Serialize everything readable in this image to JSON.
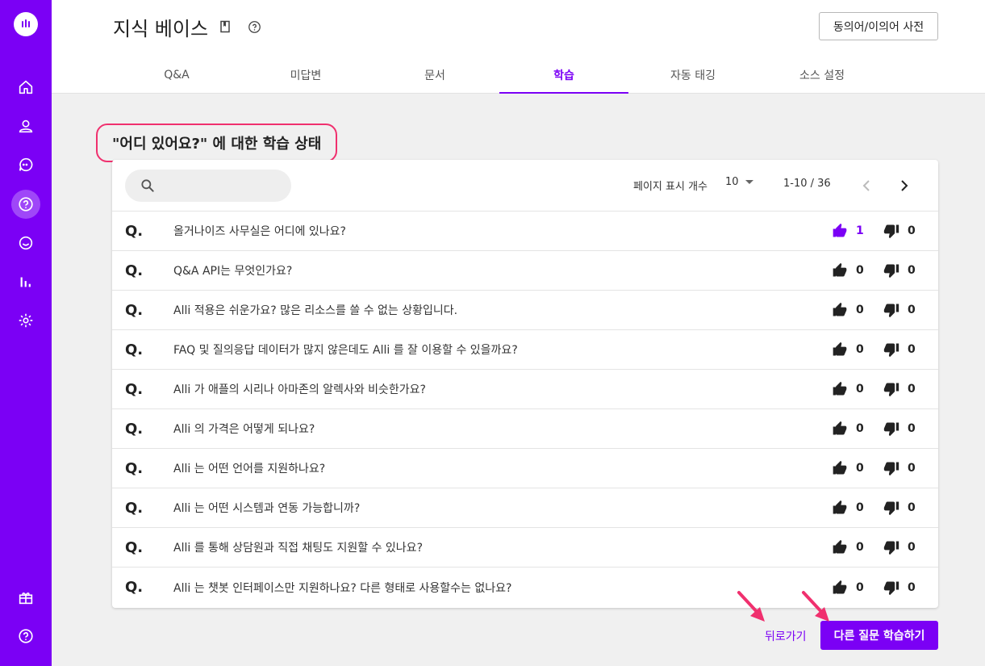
{
  "header": {
    "title": "지식 베이스",
    "dictionary_button": "동의어/이의어 사전"
  },
  "tabs": [
    {
      "label": "Q&A"
    },
    {
      "label": "미답변"
    },
    {
      "label": "문서"
    },
    {
      "label": "학습",
      "active": true
    },
    {
      "label": "자동 태깅"
    },
    {
      "label": "소스 설정"
    }
  ],
  "section": {
    "title": "\"어디 있어요?\" 에 대한 학습 상태"
  },
  "search": {
    "value": ""
  },
  "pagination": {
    "per_page_label": "페이지 표시 개수",
    "per_page_value": "10",
    "range": "1-10 / 36"
  },
  "rows": [
    {
      "q": "Q.",
      "text": "올거나이즈 사무실은 어디에 있나요?",
      "likes": "1",
      "dislikes": "0",
      "liked": true
    },
    {
      "q": "Q.",
      "text": "Q&A API는 무엇인가요?",
      "likes": "0",
      "dislikes": "0",
      "liked": false
    },
    {
      "q": "Q.",
      "text": "Alli 적용은 쉬운가요? 많은 리소스를 쓸 수 없는 상황입니다.",
      "likes": "0",
      "dislikes": "0",
      "liked": false
    },
    {
      "q": "Q.",
      "text": "FAQ 및 질의응답 데이터가 많지 않은데도 Alli 를 잘 이용할 수 있을까요?",
      "likes": "0",
      "dislikes": "0",
      "liked": false
    },
    {
      "q": "Q.",
      "text": "Alli 가 애플의 시리나 아마존의 알렉사와 비슷한가요?",
      "likes": "0",
      "dislikes": "0",
      "liked": false
    },
    {
      "q": "Q.",
      "text": "Alli 의 가격은 어떻게 되나요?",
      "likes": "0",
      "dislikes": "0",
      "liked": false
    },
    {
      "q": "Q.",
      "text": "Alli 는 어떤 언어를 지원하나요?",
      "likes": "0",
      "dislikes": "0",
      "liked": false
    },
    {
      "q": "Q.",
      "text": "Alli 는 어떤 시스템과 연동 가능합니까?",
      "likes": "0",
      "dislikes": "0",
      "liked": false
    },
    {
      "q": "Q.",
      "text": "Alli 를 통해 상담원과 직접 채팅도 지원할 수 있나요?",
      "likes": "0",
      "dislikes": "0",
      "liked": false
    },
    {
      "q": "Q.",
      "text": "Alli 는 챗봇 인터페이스만 지원하나요? 다른 형태로 사용할수는 없나요?",
      "likes": "0",
      "dislikes": "0",
      "liked": false
    }
  ],
  "footer": {
    "back_label": "뒤로가기",
    "primary_label": "다른 질문 학습하기"
  },
  "sidebar": {
    "items": [
      {
        "icon": "home-icon"
      },
      {
        "icon": "user-icon"
      },
      {
        "icon": "chat-icon"
      },
      {
        "icon": "knowledge-base-icon",
        "active": true
      },
      {
        "icon": "conversation-icon"
      },
      {
        "icon": "analytics-icon"
      },
      {
        "icon": "settings-icon"
      },
      {
        "icon": "gift-icon"
      },
      {
        "icon": "help-icon"
      }
    ]
  },
  "colors": {
    "brand": "#7b00f5",
    "highlight": "#f0306e",
    "background": "#f0f0f0"
  }
}
